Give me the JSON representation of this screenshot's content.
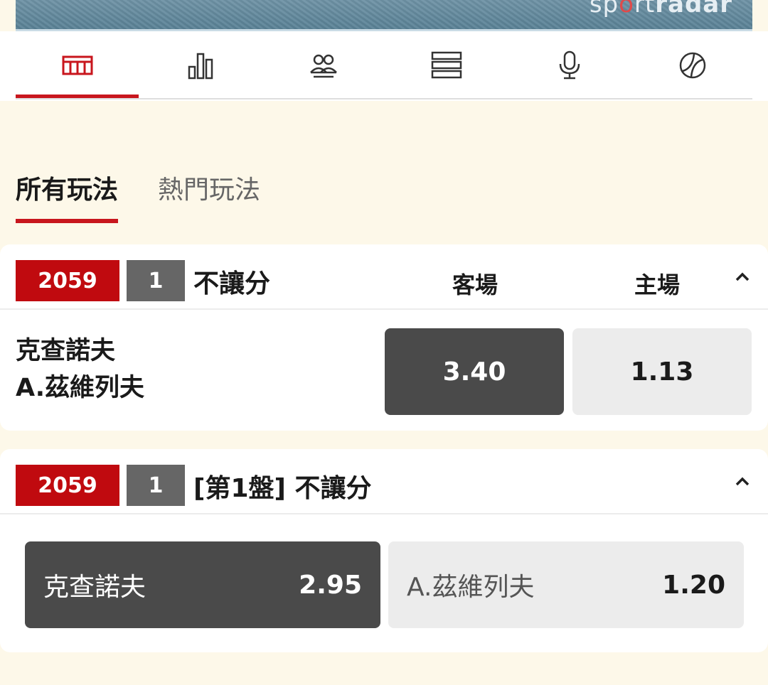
{
  "banner": {
    "brand_part1": "sp",
    "brand_part2": "o",
    "brand_part3": "rt",
    "brand_part4": "radar"
  },
  "nav": {
    "icons": [
      "court-icon",
      "stats-icon",
      "lineups-icon",
      "list-icon",
      "commentary-mic-icon",
      "tennis-ball-icon"
    ],
    "active_index": 0
  },
  "market_tabs": [
    {
      "label": "所有玩法",
      "active": true
    },
    {
      "label": "熱門玩法",
      "active": false
    }
  ],
  "markets": [
    {
      "code": "2059",
      "num": "1",
      "title": "不讓分",
      "col_away": "客場",
      "col_home": "主場",
      "team_away": "克查諾夫",
      "team_home": "A.茲維列夫",
      "odds_away": "3.40",
      "odds_home": "1.13"
    },
    {
      "code": "2059",
      "num": "1",
      "title": "[第1盤] 不讓分",
      "sel1_name": "克查諾夫",
      "sel1_odds": "2.95",
      "sel2_name": "A.茲維列夫",
      "sel2_odds": "1.20"
    }
  ],
  "colors": {
    "accent": "#c8161d",
    "badge_red": "#c00a0f",
    "badge_grey": "#666666",
    "selected": "#4a4a4a",
    "unselected": "#ececec",
    "background": "#fdf8e9"
  }
}
